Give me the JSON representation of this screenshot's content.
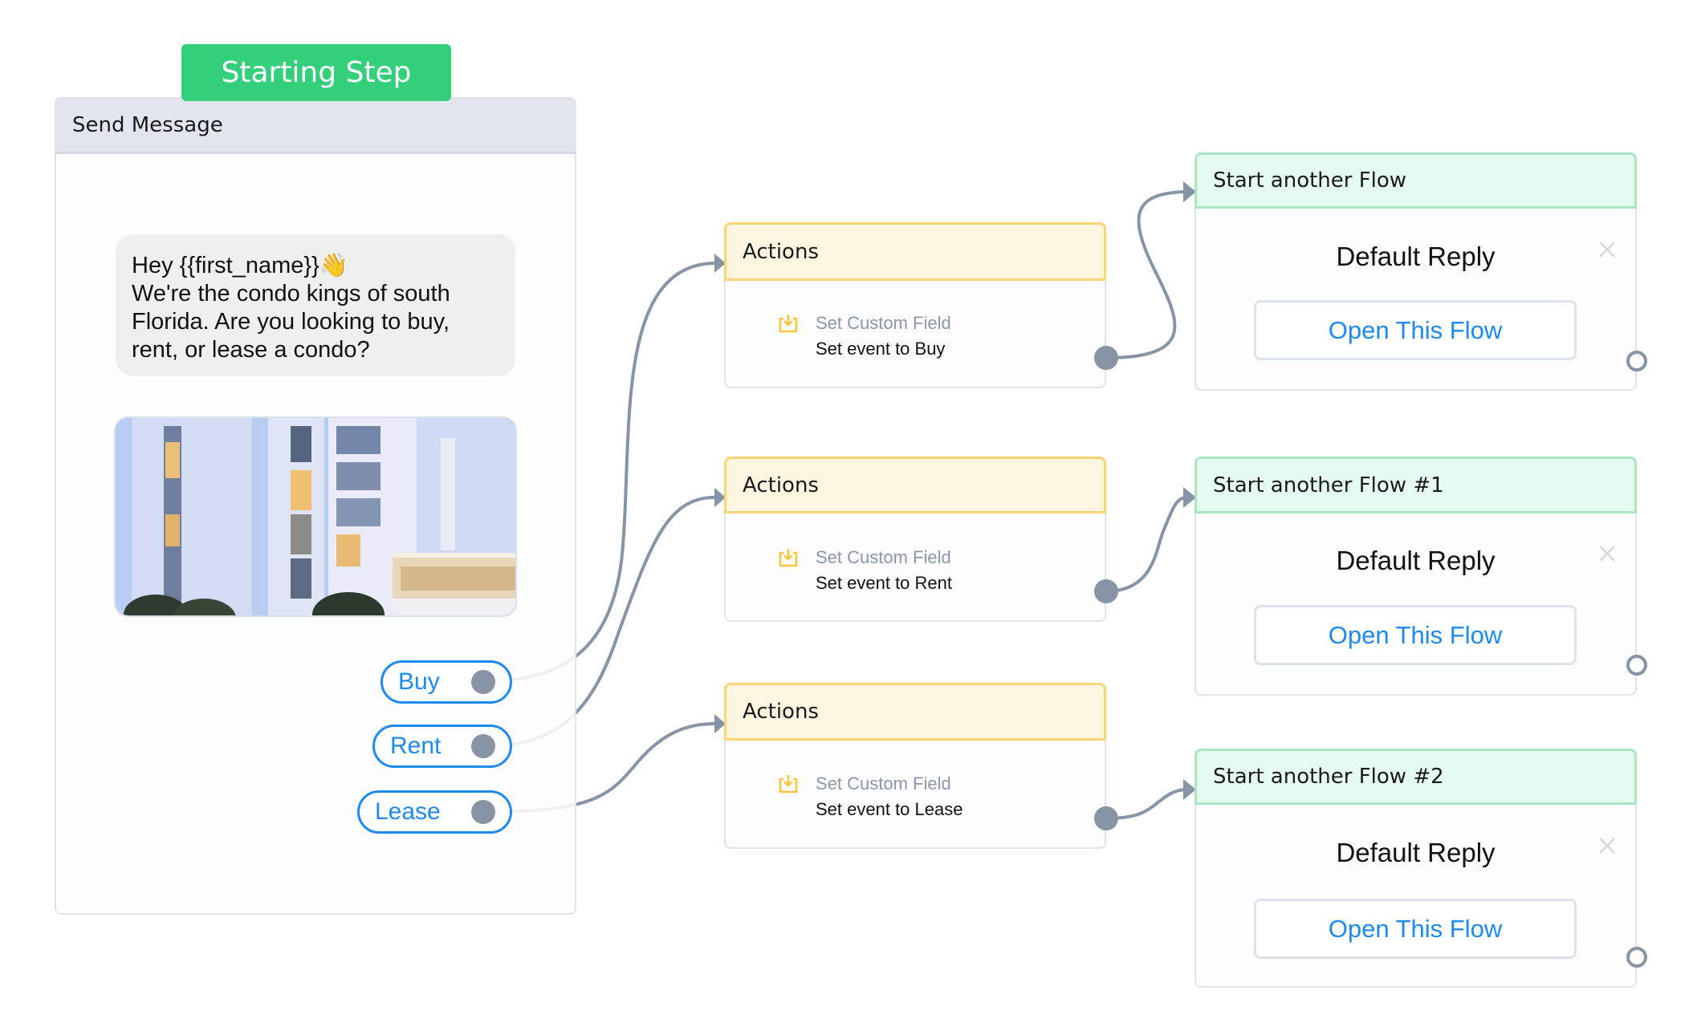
{
  "start_node": {
    "badge": "Starting Step",
    "header": "Send Message",
    "message": "Hey {{first_name}}👋\nWe're the condo kings of south Florida. Are you looking to buy, rent, or lease a condo?",
    "image_alt": "condo-building-photo",
    "buttons": [
      {
        "label": "Buy"
      },
      {
        "label": "Rent"
      },
      {
        "label": "Lease"
      }
    ]
  },
  "action_nodes": [
    {
      "header": "Actions",
      "action_type": "Set Custom Field",
      "action_value": "Set event to Buy",
      "icon": "download-icon"
    },
    {
      "header": "Actions",
      "action_type": "Set Custom Field",
      "action_value": "Set event to Rent",
      "icon": "download-icon"
    },
    {
      "header": "Actions",
      "action_type": "Set Custom Field",
      "action_value": "Set event to Lease",
      "icon": "download-icon"
    }
  ],
  "flow_nodes": [
    {
      "header": "Start another Flow",
      "flow_name": "Default Reply",
      "button": "Open This Flow"
    },
    {
      "header": "Start another Flow #1",
      "flow_name": "Default Reply",
      "button": "Open This Flow"
    },
    {
      "header": "Start another Flow #2",
      "flow_name": "Default Reply",
      "button": "Open This Flow"
    }
  ],
  "colors": {
    "starting_step": "#33cf7a",
    "link_blue": "#1c8af0",
    "connector": "#8794a6",
    "actions_border": "#fdd673",
    "flow_border": "#a9e7c3"
  }
}
